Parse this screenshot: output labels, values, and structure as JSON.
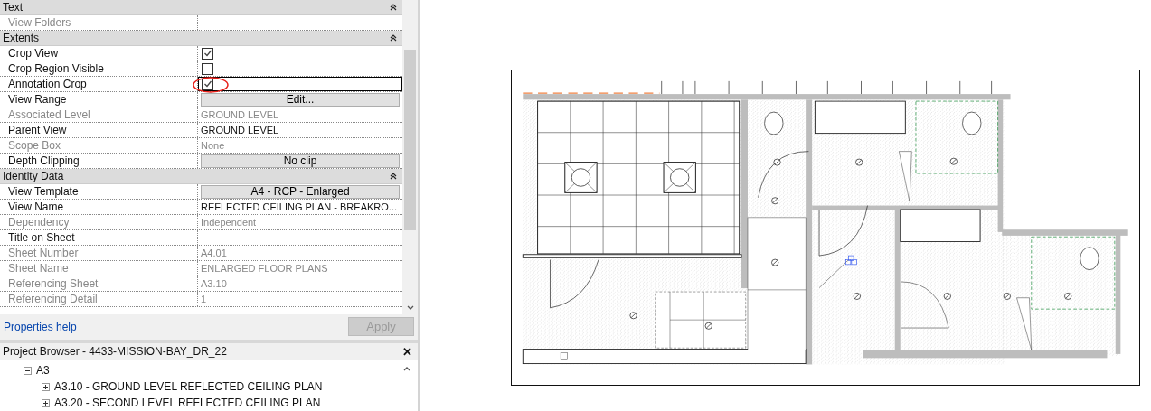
{
  "properties": {
    "groups": [
      {
        "name": "Text",
        "expanded": true,
        "rows": [
          {
            "name": "View Folders",
            "kind": "text",
            "value": "",
            "disabled": true,
            "selected": false
          }
        ]
      },
      {
        "name": "Extents",
        "expanded": true,
        "rows": [
          {
            "name": "Crop View",
            "kind": "checkbox",
            "checked": true,
            "disabled": false,
            "selected": false
          },
          {
            "name": "Crop Region Visible",
            "kind": "checkbox",
            "checked": false,
            "disabled": false,
            "selected": false
          },
          {
            "name": "Annotation Crop",
            "kind": "checkbox",
            "checked": true,
            "disabled": false,
            "selected": true
          },
          {
            "name": "View Range",
            "kind": "button",
            "value": "Edit...",
            "disabled": false,
            "selected": false
          },
          {
            "name": "Associated Level",
            "kind": "text",
            "value": "GROUND LEVEL",
            "disabled": true,
            "selected": false
          },
          {
            "name": "Parent View",
            "kind": "text",
            "value": "GROUND LEVEL",
            "disabled": false,
            "selected": false
          },
          {
            "name": "Scope Box",
            "kind": "text",
            "value": "None",
            "disabled": true,
            "selected": false
          },
          {
            "name": "Depth Clipping",
            "kind": "button",
            "value": "No clip",
            "disabled": false,
            "selected": false
          }
        ]
      },
      {
        "name": "Identity Data",
        "expanded": true,
        "rows": [
          {
            "name": "View Template",
            "kind": "button",
            "value": "A4 - RCP - Enlarged",
            "disabled": false,
            "selected": false
          },
          {
            "name": "View Name",
            "kind": "text",
            "value": "REFLECTED CEILING PLAN - BREAKRO...",
            "disabled": false,
            "selected": false
          },
          {
            "name": "Dependency",
            "kind": "text",
            "value": "Independent",
            "disabled": true,
            "selected": false
          },
          {
            "name": "Title on Sheet",
            "kind": "text",
            "value": "",
            "disabled": false,
            "selected": false
          },
          {
            "name": "Sheet Number",
            "kind": "text",
            "value": "A4.01",
            "disabled": true,
            "selected": false
          },
          {
            "name": "Sheet Name",
            "kind": "text",
            "value": "ENLARGED FLOOR PLANS",
            "disabled": true,
            "selected": false
          },
          {
            "name": "Referencing Sheet",
            "kind": "text",
            "value": "A3.10",
            "disabled": true,
            "selected": false
          },
          {
            "name": "Referencing Detail",
            "kind": "text",
            "value": "1",
            "disabled": true,
            "selected": false
          }
        ]
      }
    ],
    "help_link": "Properties help",
    "apply_button": {
      "label": "Apply",
      "disabled": true
    }
  },
  "project_browser": {
    "title": "Project Browser - 4433-MISSION-BAY_DR_22",
    "close": "✕",
    "tree": [
      {
        "label": "A3",
        "expanded": true,
        "children": [
          {
            "label": "A3.10 - GROUND LEVEL REFLECTED CEILING PLAN",
            "expanded": false
          },
          {
            "label": "A3.20 - SECOND LEVEL REFLECTED CEILING PLAN",
            "expanded": false
          }
        ]
      }
    ]
  }
}
